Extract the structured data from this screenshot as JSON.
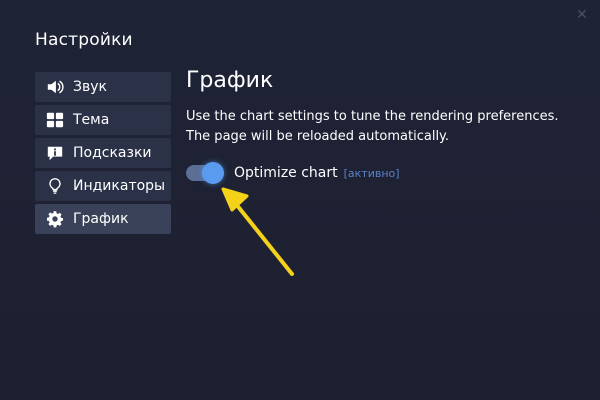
{
  "dialog": {
    "title": "Настройки",
    "close_icon": "close-icon"
  },
  "sidebar": {
    "items": [
      {
        "label": "Звук",
        "icon": "speaker-icon"
      },
      {
        "label": "Тема",
        "icon": "grid-icon"
      },
      {
        "label": "Подсказки",
        "icon": "info-icon"
      },
      {
        "label": "Индикаторы",
        "icon": "lightbulb-icon"
      },
      {
        "label": "График",
        "icon": "gear-icon",
        "active": true
      }
    ]
  },
  "content": {
    "title": "График",
    "description_line1": "Use the chart settings to tune the rendering preferences.",
    "description_line2": "The page will be reloaded automatically.",
    "toggle": {
      "label": "Optimize chart",
      "status": "[активно]",
      "on": true
    }
  },
  "colors": {
    "background": "#1d2130",
    "sidebar_item": "#2b3147",
    "toggle_track": "#5a6e96",
    "toggle_knob": "#5a9bef",
    "status_text": "#5b82c4",
    "annotation_arrow": "#f5d21a"
  }
}
